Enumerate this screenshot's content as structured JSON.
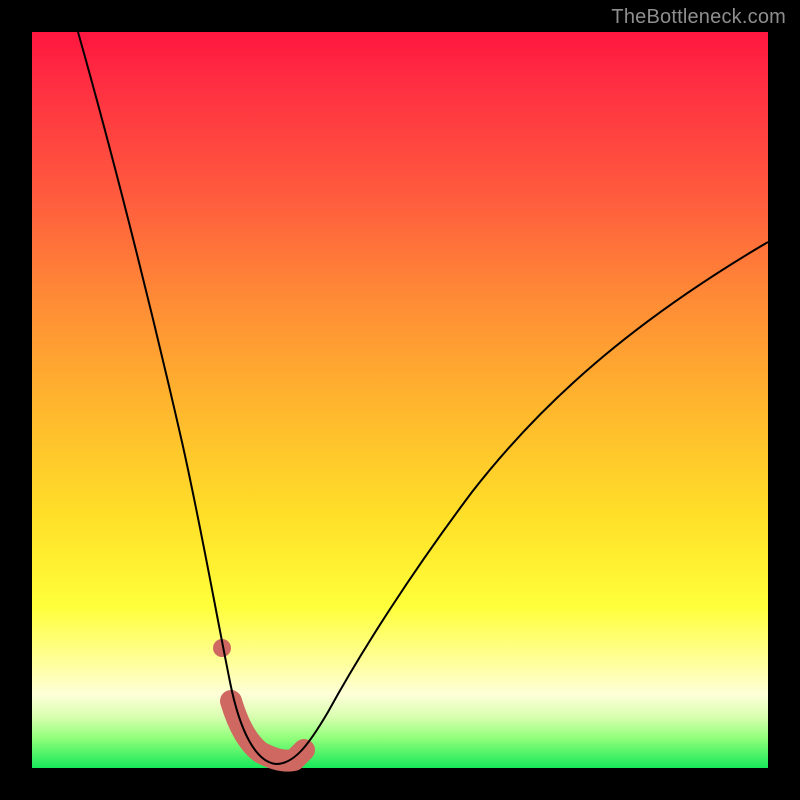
{
  "watermark": "TheBottleneck.com",
  "chart_data": {
    "type": "line",
    "title": "",
    "xlabel": "",
    "ylabel": "",
    "xlim": [
      0,
      100
    ],
    "ylim": [
      0,
      100
    ],
    "grid": false,
    "legend": false,
    "background": "rainbow-vertical-gradient",
    "series": [
      {
        "name": "bottleneck-curve",
        "style": "thin-black",
        "x": [
          6,
          10,
          14,
          18,
          22,
          24,
          26,
          28,
          30,
          32,
          34,
          36,
          40,
          46,
          54,
          62,
          70,
          78,
          86,
          94,
          100
        ],
        "y": [
          100,
          88,
          75,
          60,
          42,
          32,
          20,
          10,
          3,
          0,
          0,
          1,
          5,
          13,
          26,
          38,
          48,
          57,
          64,
          69,
          72
        ]
      },
      {
        "name": "optimal-range",
        "style": "thick-salmon",
        "x": [
          26.5,
          28,
          30,
          32,
          34,
          36
        ],
        "y": [
          8,
          3,
          0.5,
          0.5,
          1.5,
          4
        ]
      }
    ],
    "markers": [
      {
        "name": "highlight-dot",
        "x": 25.5,
        "y": 16,
        "style": "salmon-dot"
      }
    ],
    "notes": "Values are approximate, read from pixel positions on an unlabeled chart. x in percent across plot width left→right; y in percent of plot height where 0 = bottom (green) and 100 = top (red)."
  }
}
